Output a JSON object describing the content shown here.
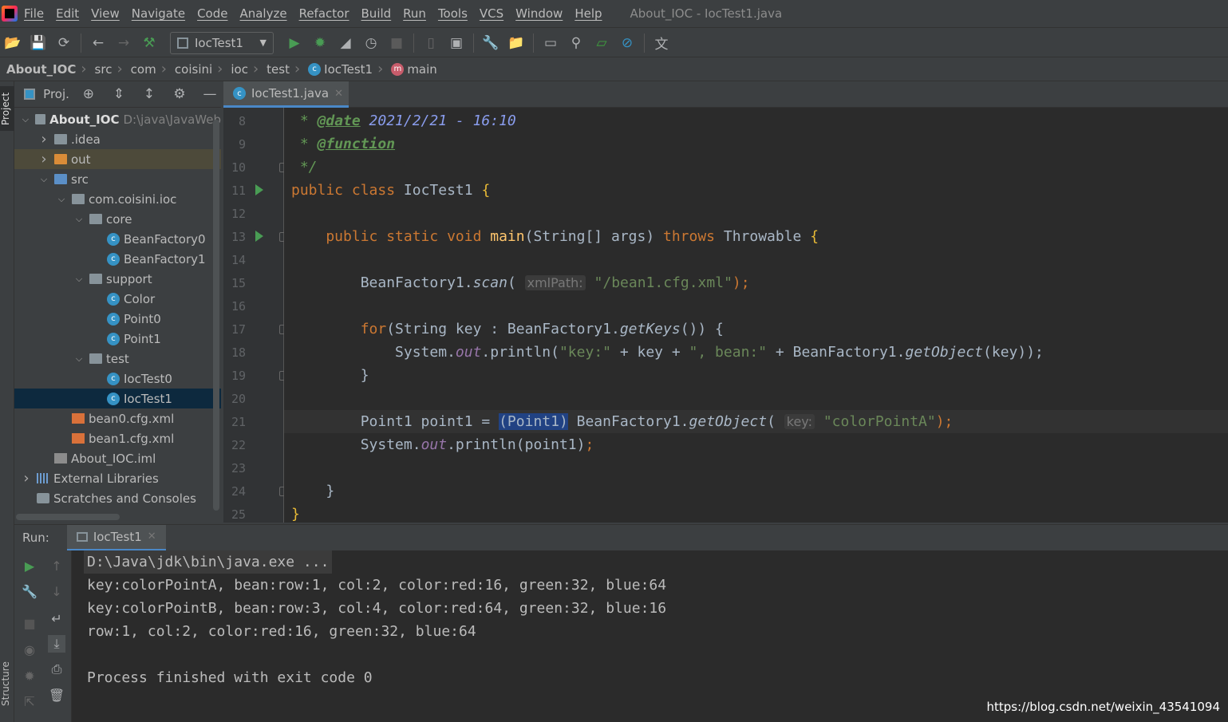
{
  "window": {
    "title": "About_IOC - IocTest1.java"
  },
  "menu": [
    "File",
    "Edit",
    "View",
    "Navigate",
    "Code",
    "Analyze",
    "Refactor",
    "Build",
    "Run",
    "Tools",
    "VCS",
    "Window",
    "Help"
  ],
  "toolbar": {
    "run_config": "IocTest1",
    "icons": [
      "open-icon",
      "save-icon",
      "sync-icon",
      "back-icon",
      "forward-icon",
      "build-hammer-icon",
      "run-icon",
      "debug-icon",
      "coverage-icon",
      "profile-icon",
      "stop-icon",
      "device-icon",
      "sdk-icon",
      "settings-wrench-icon",
      "project-structure-icon",
      "terminal-icon",
      "search-icon",
      "monitor-icon",
      "no-icon",
      "translate-icon"
    ]
  },
  "breadcrumb": [
    "About_IOC",
    "src",
    "com",
    "coisini",
    "ioc",
    "test",
    "IocTest1",
    "main"
  ],
  "side": {
    "project": "Project",
    "structure": "Structure"
  },
  "project": {
    "header": "Proj.",
    "tree": [
      {
        "label": "About_IOC",
        "hint": "D:\\java\\JavaWeb",
        "depth": 0,
        "arrow": "v",
        "icon": "folder",
        "bold": true
      },
      {
        "label": ".idea",
        "depth": 1,
        "arrow": ">",
        "icon": "folder"
      },
      {
        "label": "out",
        "depth": 1,
        "arrow": ">",
        "icon": "folder excl",
        "state": "excl"
      },
      {
        "label": "src",
        "depth": 1,
        "arrow": "v",
        "icon": "folder src"
      },
      {
        "label": "com.coisini.ioc",
        "depth": 2,
        "arrow": "v",
        "icon": "folder"
      },
      {
        "label": "core",
        "depth": 3,
        "arrow": "v",
        "icon": "folder"
      },
      {
        "label": "BeanFactory0",
        "depth": 4,
        "icon": "class"
      },
      {
        "label": "BeanFactory1",
        "depth": 4,
        "icon": "class"
      },
      {
        "label": "support",
        "depth": 3,
        "arrow": "v",
        "icon": "folder"
      },
      {
        "label": "Color",
        "depth": 4,
        "icon": "class"
      },
      {
        "label": "Point0",
        "depth": 4,
        "icon": "class"
      },
      {
        "label": "Point1",
        "depth": 4,
        "icon": "class"
      },
      {
        "label": "test",
        "depth": 3,
        "arrow": "v",
        "icon": "folder"
      },
      {
        "label": "IocTest0",
        "depth": 4,
        "icon": "class"
      },
      {
        "label": "IocTest1",
        "depth": 4,
        "icon": "class",
        "state": "sel"
      },
      {
        "label": "bean0.cfg.xml",
        "depth": 2,
        "icon": "xml"
      },
      {
        "label": "bean1.cfg.xml",
        "depth": 2,
        "icon": "xml"
      },
      {
        "label": "About_IOC.iml",
        "depth": 1,
        "icon": "iml"
      },
      {
        "label": "External Libraries",
        "depth": 0,
        "arrow": ">",
        "icon": "lib"
      },
      {
        "label": "Scratches and Consoles",
        "depth": 0,
        "icon": "scr"
      }
    ]
  },
  "editor": {
    "tab": "IocTest1.java",
    "current_line": 21,
    "lines": [
      {
        "n": 8,
        "t": [
          [
            " * ",
            "doc"
          ],
          [
            "@date",
            "dtag"
          ],
          [
            " 2021/2/21 - 16:10",
            "dval"
          ]
        ]
      },
      {
        "n": 9,
        "t": [
          [
            " * ",
            "doc"
          ],
          [
            "@function",
            "dtag"
          ]
        ]
      },
      {
        "n": 10,
        "fold": true,
        "t": [
          [
            " */",
            "doc"
          ]
        ]
      },
      {
        "n": 11,
        "run": true,
        "t": [
          [
            "public class ",
            "kw"
          ],
          [
            "IocTest1 ",
            ""
          ],
          [
            "{",
            "br"
          ]
        ]
      },
      {
        "n": 12,
        "t": []
      },
      {
        "n": 13,
        "run": true,
        "fold": true,
        "t": [
          [
            "    public static void ",
            "kw"
          ],
          [
            "main",
            "fn"
          ],
          [
            "(String[] args) ",
            ""
          ],
          [
            "throws ",
            "kw"
          ],
          [
            "Throwable ",
            ""
          ],
          [
            "{",
            "br"
          ]
        ]
      },
      {
        "n": 14,
        "t": []
      },
      {
        "n": 15,
        "t": [
          [
            "        BeanFactory1.",
            ""
          ],
          [
            "scan",
            "it"
          ],
          [
            "( ",
            ""
          ],
          [
            "xmlPath:",
            "inl"
          ],
          [
            " ",
            ""
          ],
          [
            "\"/bean1.cfg.xml\"",
            "st"
          ],
          [
            ");",
            "kw"
          ]
        ]
      },
      {
        "n": 16,
        "t": []
      },
      {
        "n": 17,
        "fold": true,
        "t": [
          [
            "        ",
            ""
          ],
          [
            "for",
            "kw"
          ],
          [
            "(String key : BeanFactory1.",
            ""
          ],
          [
            "getKeys",
            "it"
          ],
          [
            "()) {",
            ""
          ]
        ]
      },
      {
        "n": 18,
        "t": [
          [
            "            System.",
            ""
          ],
          [
            "out",
            "fld"
          ],
          [
            ".println(",
            ""
          ],
          [
            "\"key:\"",
            "st"
          ],
          [
            " + key + ",
            ""
          ],
          [
            "\", bean:\"",
            "st"
          ],
          [
            " + BeanFactory1.",
            ""
          ],
          [
            "getObject",
            "it"
          ],
          [
            "(key));",
            ""
          ]
        ]
      },
      {
        "n": 19,
        "fold": true,
        "t": [
          [
            "        }",
            ""
          ]
        ]
      },
      {
        "n": 20,
        "t": []
      },
      {
        "n": 21,
        "t": [
          [
            "        Point1 point1 = ",
            ""
          ],
          [
            "(Point1)",
            "selc"
          ],
          [
            " BeanFactory1.",
            ""
          ],
          [
            "getObject",
            "it"
          ],
          [
            "( ",
            ""
          ],
          [
            "key:",
            "inl"
          ],
          [
            " ",
            ""
          ],
          [
            "\"colorPointA\"",
            "st"
          ],
          [
            ");",
            "kw"
          ]
        ]
      },
      {
        "n": 22,
        "t": [
          [
            "        System.",
            ""
          ],
          [
            "out",
            "fld"
          ],
          [
            ".println(point1)",
            ""
          ],
          [
            ";",
            "kw"
          ]
        ]
      },
      {
        "n": 23,
        "t": []
      },
      {
        "n": 24,
        "fold": true,
        "t": [
          [
            "    }",
            ""
          ]
        ]
      },
      {
        "n": 25,
        "t": [
          [
            "}",
            "br"
          ]
        ]
      }
    ]
  },
  "run": {
    "label": "Run:",
    "tab": "IocTest1",
    "output": [
      "D:\\Java\\jdk\\bin\\java.exe ...",
      "key:colorPointA, bean:row:1, col:2, color:red:16, green:32, blue:64",
      "key:colorPointB, bean:row:3, col:4, color:red:64, green:32, blue:16",
      "row:1, col:2, color:red:16, green:32, blue:64",
      "",
      "Process finished with exit code 0"
    ]
  },
  "watermark": "https://blog.csdn.net/weixin_43541094"
}
